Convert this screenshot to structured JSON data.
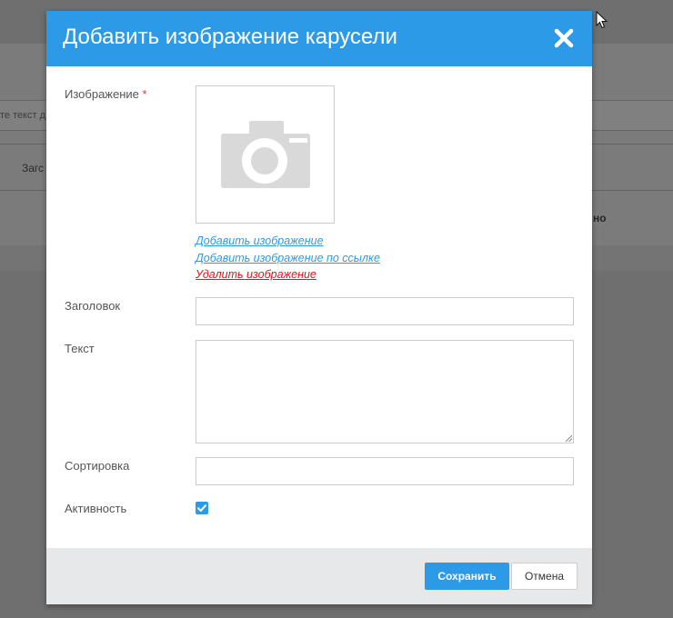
{
  "background": {
    "input_placeholder": "те текст д",
    "row_label": "Загс",
    "right_text": "но"
  },
  "modal": {
    "title": "Добавить изображение карусели",
    "close_symbol": "✕",
    "fields": {
      "image_label": "Изображение",
      "required_mark": "*",
      "add_image_link": "Добавить изображение",
      "add_image_url_link": "Добавить изображение по ссылке",
      "delete_image_link": "Удалить изображение",
      "title_label": "Заголовок",
      "title_value": "",
      "text_label": "Текст",
      "text_value": "",
      "sort_label": "Сортировка",
      "sort_value": "",
      "active_label": "Активность",
      "active_checked": true
    },
    "footer": {
      "save_label": "Сохранить",
      "cancel_label": "Отмена"
    }
  },
  "colors": {
    "accent": "#2d9ae8",
    "danger": "#e0141e",
    "overlay": "#6f6f6f"
  },
  "icons": {
    "image_placeholder": "camera-icon",
    "close": "close-icon",
    "check": "check-icon",
    "cursor": "mouse-cursor-icon"
  }
}
